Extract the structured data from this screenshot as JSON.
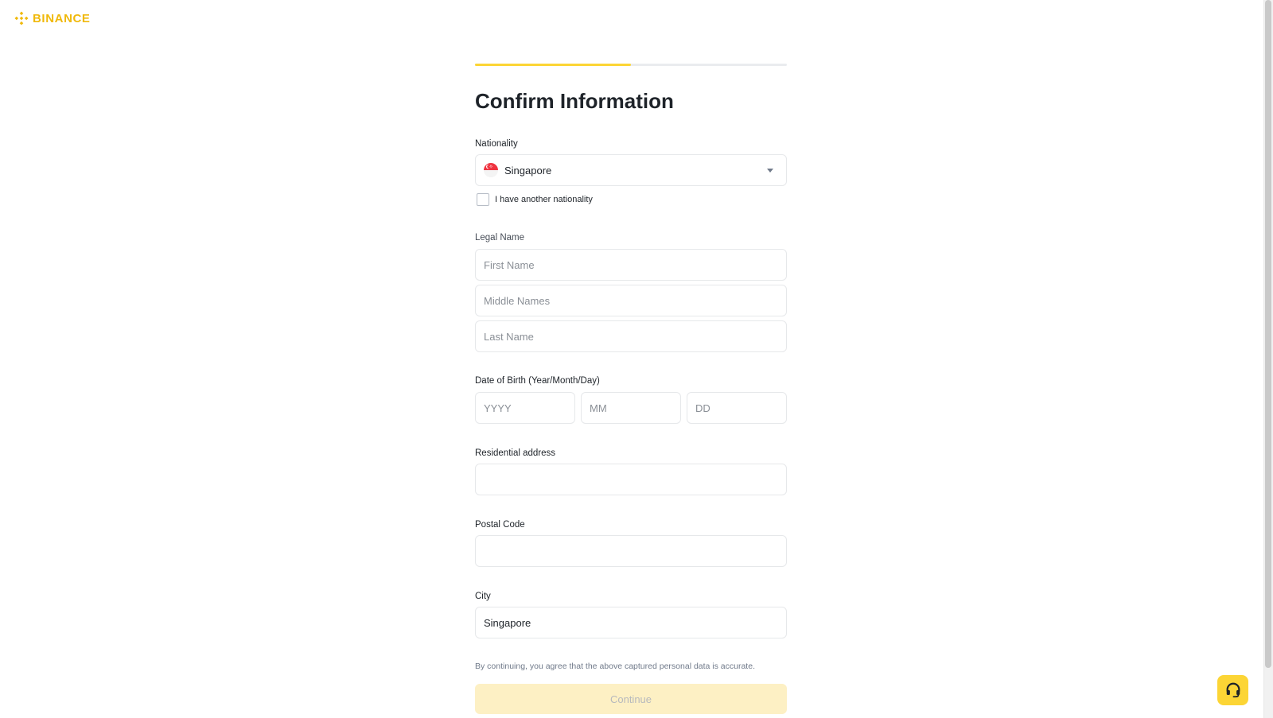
{
  "brand": {
    "name": "BINANCE",
    "logo_icon": "binance-diamond-logo",
    "accent": "#f0b90b"
  },
  "progress": {
    "current_step": 1,
    "total_steps": 2,
    "fill_fraction": 0.5,
    "fill_color": "#fcd535"
  },
  "form": {
    "title": "Confirm Information",
    "nationality": {
      "label": "Nationality",
      "value": "Singapore",
      "flag_icon": "singapore-flag-icon",
      "another_nationality_label": "I have another nationality",
      "another_nationality_checked": false
    },
    "legal_name": {
      "label": "Legal Name",
      "first_placeholder": "First Name",
      "middle_placeholder": "Middle Names",
      "last_placeholder": "Last Name"
    },
    "dob": {
      "label": "Date of Birth (Year/Month/Day)",
      "year_placeholder": "YYYY",
      "month_placeholder": "MM",
      "day_placeholder": "DD"
    },
    "address": {
      "label": "Residential address",
      "value": ""
    },
    "postal_code": {
      "label": "Postal Code",
      "value": ""
    },
    "city": {
      "label": "City",
      "value": "Singapore"
    },
    "notice": "By continuing, you agree that the above captured personal data is accurate.",
    "continue_label": "Continue",
    "continue_enabled": false
  },
  "support": {
    "icon": "headset-icon",
    "color": "#fcd535"
  }
}
